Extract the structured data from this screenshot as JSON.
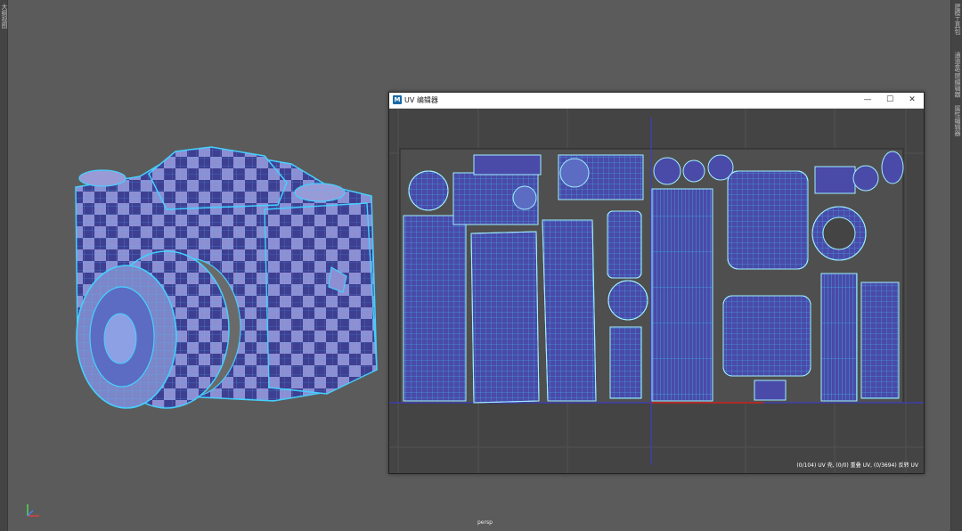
{
  "left_panel": {
    "label": "大纲视图"
  },
  "right_panel": {
    "labels": [
      "建模工具包",
      "通道盒/层编辑器",
      "属性编辑器"
    ]
  },
  "viewport": {
    "camera_label": "persp"
  },
  "uv_editor": {
    "app_icon": "M",
    "title": "UV 编辑器",
    "status": "(0/104) UV 壳, (0/0) 重叠 UV, (0/3694) 反转 UV",
    "window_buttons": {
      "minimize": "—",
      "maximize": "☐",
      "close": "✕"
    }
  },
  "colors": {
    "viewport_bg": "#5b5b5b",
    "uv_fill": "#4a4aa8",
    "uv_wire": "#33c8ff",
    "checker_dark": "#3b3b8c",
    "checker_light": "#8c8cd0"
  },
  "icons": {
    "axis": "axis-gizmo-icon",
    "app": "maya-app-icon"
  }
}
